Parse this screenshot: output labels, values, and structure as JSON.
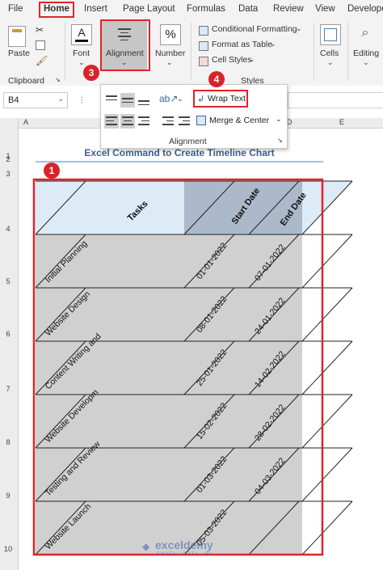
{
  "tabs": [
    "File",
    "Home",
    "Insert",
    "Page Layout",
    "Formulas",
    "Data",
    "Review",
    "View",
    "Develope"
  ],
  "ribbon": {
    "clipboard": {
      "paste": "Paste",
      "group": "Clipboard"
    },
    "font": {
      "label": "Font"
    },
    "alignment": {
      "label": "Alignment"
    },
    "number": {
      "label": "Number",
      "icon": "%"
    },
    "styles": {
      "conditional": "Conditional Formatting",
      "format_table": "Format as Table",
      "cell_styles": "Cell Styles",
      "group": "Styles"
    },
    "cells": {
      "label": "Cells"
    },
    "editing": {
      "label": "Editing"
    }
  },
  "alignment_panel": {
    "wrap_text": "Wrap Text",
    "merge_center": "Merge & Center",
    "group": "Alignment"
  },
  "name_box": {
    "value": "B4"
  },
  "columns": [
    "A",
    "D",
    "E"
  ],
  "rows": [
    "1",
    "2",
    "3",
    "4",
    "5",
    "6",
    "7",
    "8",
    "9",
    "10"
  ],
  "sheet": {
    "title": "Excel Command to Create Timeline Chart",
    "headers": {
      "tasks": "Tasks",
      "start": "Start Date",
      "end": "End Date"
    },
    "rows": [
      {
        "task": "Initial Planning",
        "start": "01-01-2022",
        "end": "07-01-2022"
      },
      {
        "task": "Website Design",
        "start": "08-01-2022",
        "end": "24-01-2022"
      },
      {
        "task": "Content Writing and",
        "start": "25-01-2022",
        "end": "14-02-2022"
      },
      {
        "task": "Website Developm",
        "start": "15-02-2022",
        "end": "28-02-2022"
      },
      {
        "task": "Testing and Review",
        "start": "01-03-2022",
        "end": "04-03-2022"
      },
      {
        "task": "Website Launch",
        "start": "05-03-2022",
        "end": ""
      }
    ]
  },
  "watermark": {
    "name": "exceldemy",
    "tagline": "EXCEL · DATA · BI"
  },
  "badges": [
    "1",
    "2",
    "3",
    "4"
  ],
  "colors": {
    "accent_red": "#e0232a",
    "header_blue": "#ddebf7",
    "header_gray": "#acb9ca",
    "row_gray": "#d0d0d0"
  }
}
